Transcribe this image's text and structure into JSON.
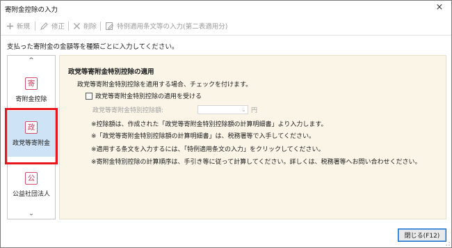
{
  "window": {
    "title": "寄附金控除の入力",
    "close_icon": "×"
  },
  "toolbar": {
    "new_label": "新規",
    "edit_label": "修正",
    "delete_label": "削除",
    "special_label": "特例適用条文等の入力(第二表適用分)"
  },
  "instruction": "支払った寄附金の金額等を種類ごとに入力してください。",
  "sidebar": {
    "scroll_up": "^",
    "scroll_down": "⌄",
    "items": [
      {
        "icon_char": "寄",
        "label": "寄附金控除",
        "selected": false
      },
      {
        "icon_char": "政",
        "label": "政党等寄附金",
        "selected": true
      },
      {
        "icon_char": "公",
        "label": "公益社団法人",
        "selected": false
      }
    ]
  },
  "main": {
    "section_title": "政党等寄附金特別控除の適用",
    "description": "政党等寄附金特別控除を適用する場合、チェックを付けます。",
    "checkbox_label": "政党等寄附金特別控除の適用を受ける",
    "checkbox_checked": false,
    "amount_label": "政党等寄附金特別控除額:",
    "amount_value": "",
    "amount_unit": "円",
    "notes": [
      "※控除額は、作成された「政党等寄附金特別控除額の計算明細書」より入力します。",
      "※「政党等寄附金特別控除額の計算明細書」は、税務署等で入手してください。",
      "※適用する条文を入力するには、「特例適用条文の入力」をクリックしてください。",
      "※寄附金特別控除の計算順序は、手引き等に従って計算してください。詳しくは、税務署等へお問い合わせください。"
    ]
  },
  "footer": {
    "close_button_label": "閉じる(F12)"
  },
  "colors": {
    "highlight": "#e8151c",
    "panel_bg": "#fbf5e8",
    "icon_accent": "#c73a5c",
    "selected_bg": "#cfe3f6"
  }
}
